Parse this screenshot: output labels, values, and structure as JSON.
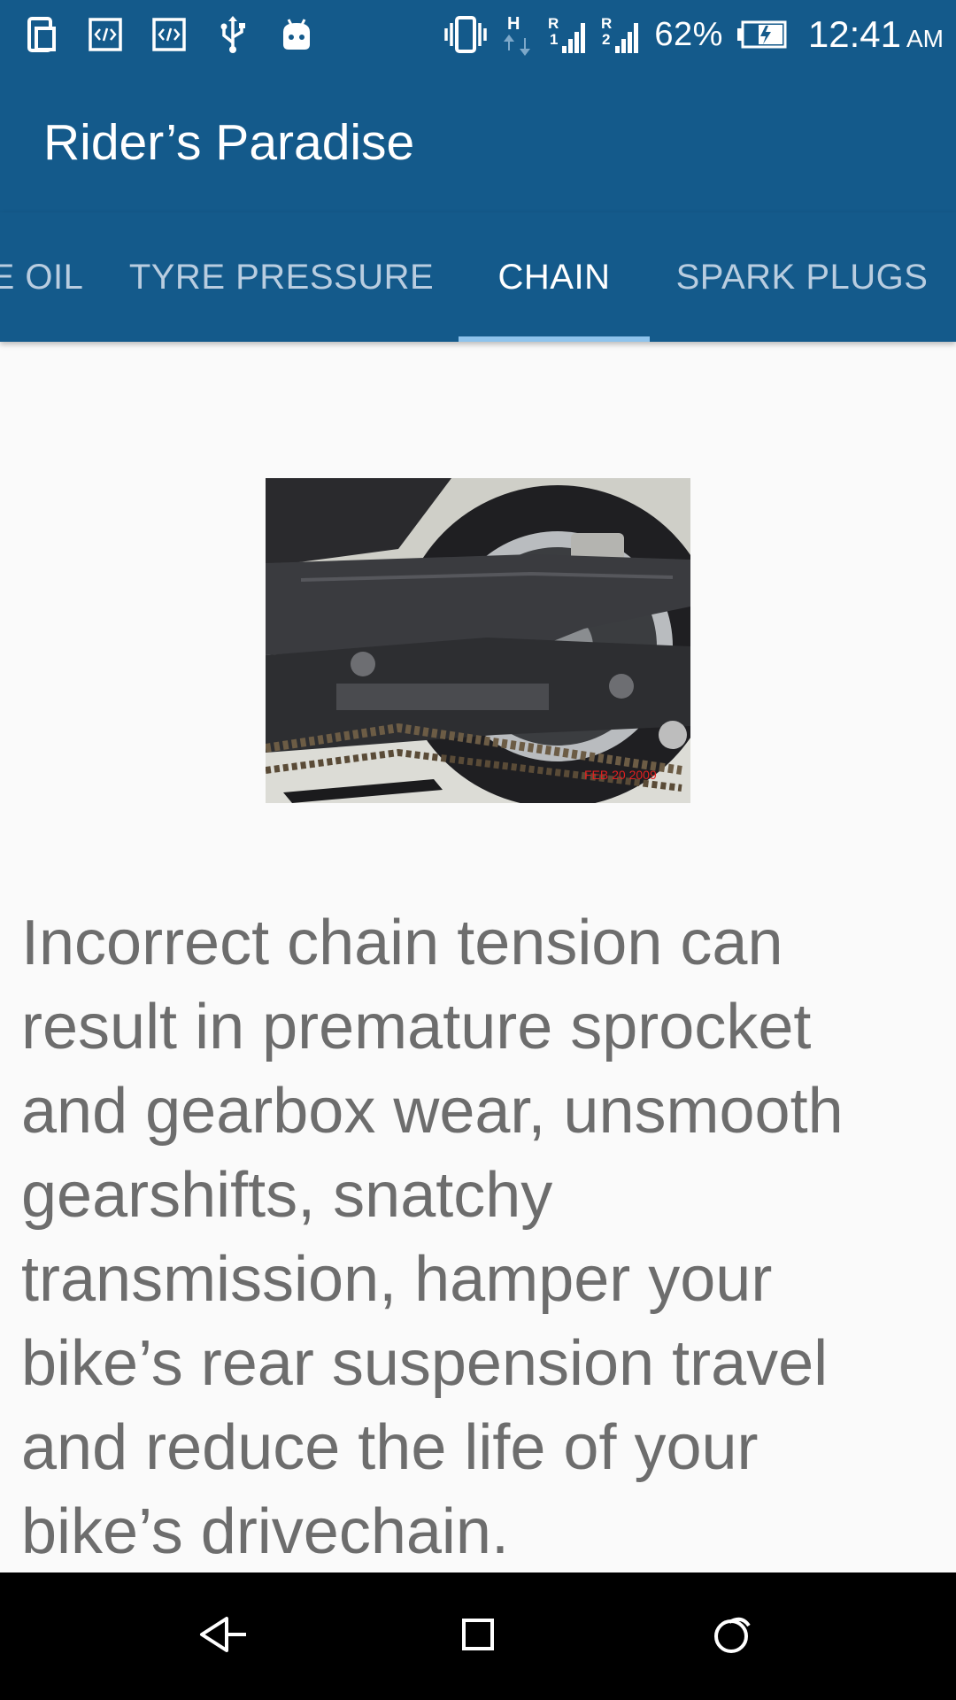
{
  "status_bar": {
    "left_icons": [
      "phone-screen-icon",
      "code-icon",
      "code-icon",
      "usb-icon",
      "android-icon"
    ],
    "right_icons": [
      "vibrate-icon",
      "network-h-icon",
      "signal-r1-icon",
      "signal-r2-icon",
      "battery-charging-icon"
    ],
    "battery_percent": "62%",
    "time": "12:41",
    "ampm": "AM"
  },
  "toolbar": {
    "title": "Rider’s Paradise"
  },
  "tabs": [
    {
      "label": "E OIL"
    },
    {
      "label": "TYRE PRESSURE"
    },
    {
      "label": "CHAIN"
    },
    {
      "label": "SPARK PLUGS"
    }
  ],
  "active_tab": "CHAIN",
  "content": {
    "image_stamp": "FEB 20 2009",
    "description": "Incorrect chain tension can result in premature sprocket and gearbox wear, unsmooth gearshifts, snatchy transmission, hamper your bike’s rear suspension travel and reduce the life of your bike’s drivechain."
  },
  "colors": {
    "primary": "#145a8b",
    "tab_indicator": "#8ec3ec",
    "text_secondary": "#6d6d6d",
    "background": "#fafafa"
  },
  "nav_bar": {
    "buttons": [
      "back-icon",
      "home-icon",
      "recents-icon"
    ]
  }
}
